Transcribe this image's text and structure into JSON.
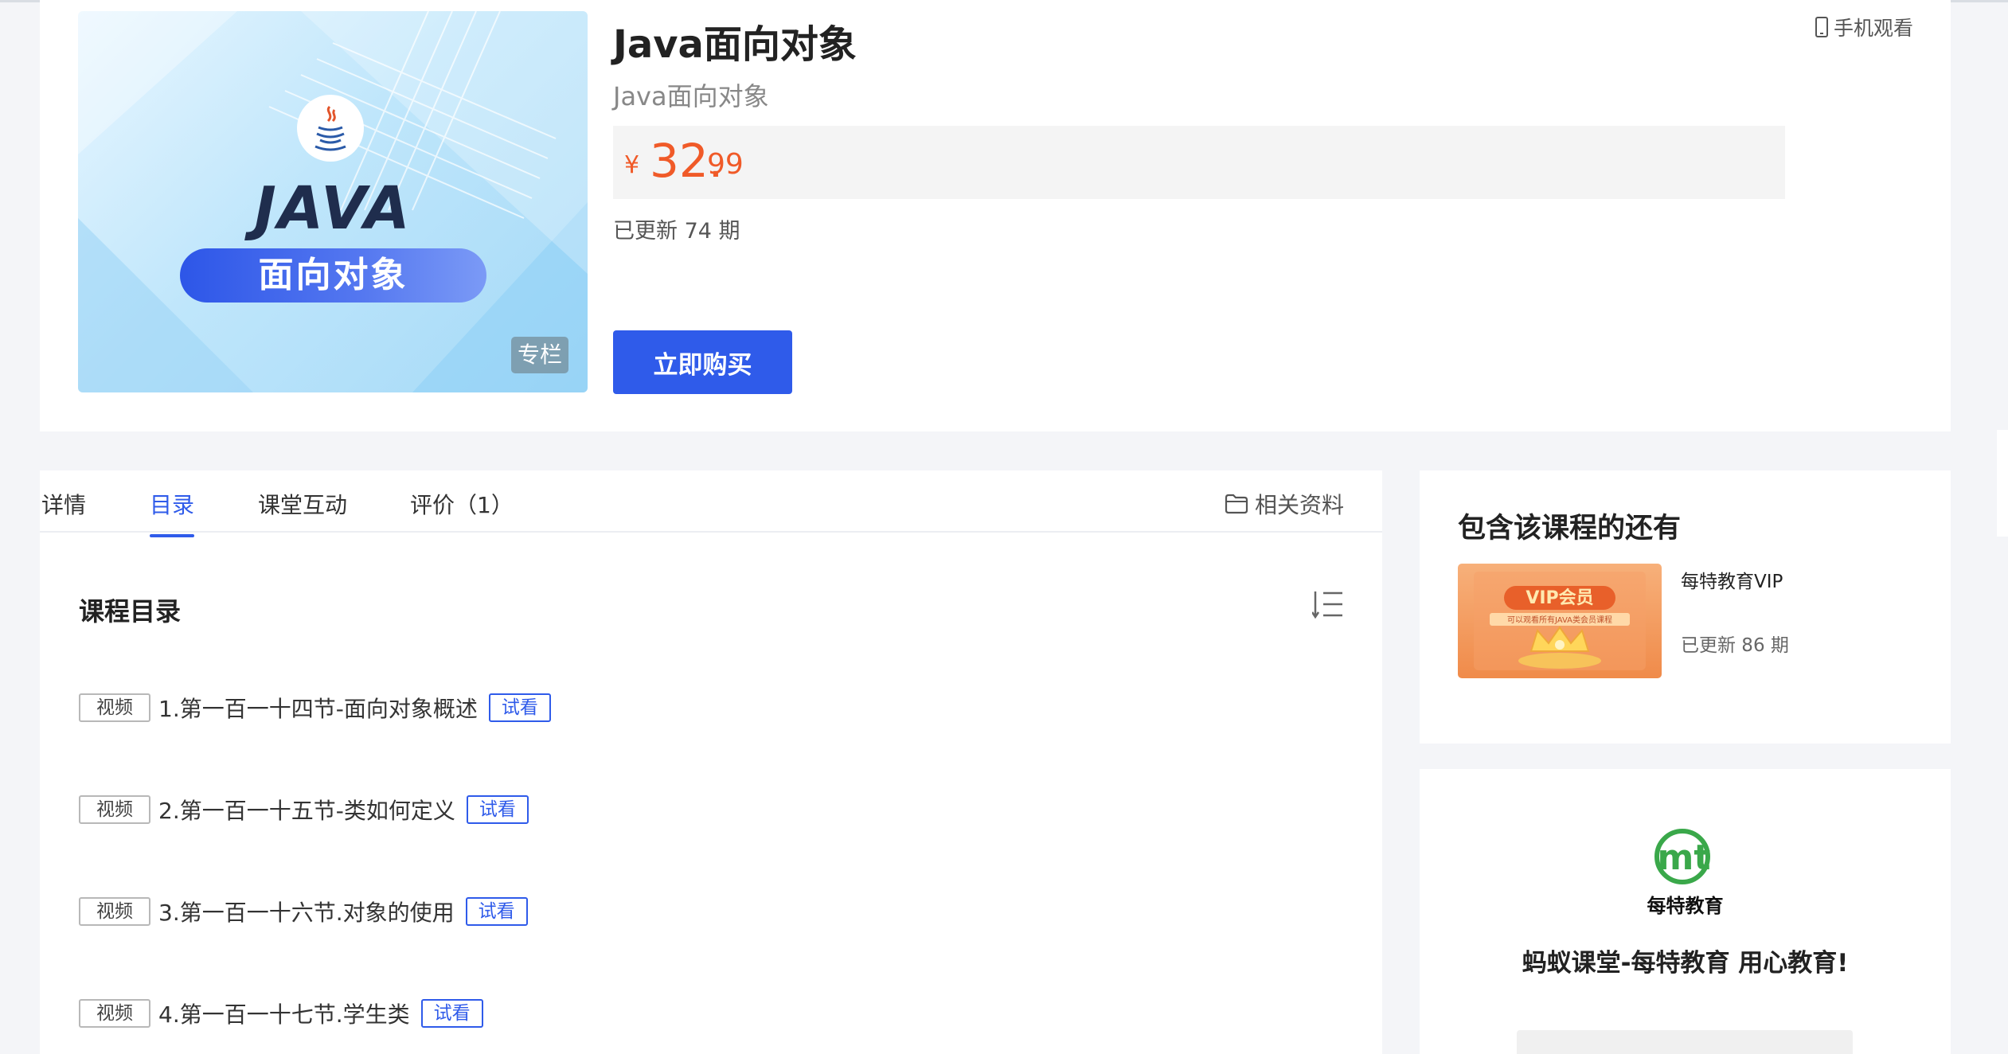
{
  "course": {
    "cover_word": "JAVA",
    "cover_pill": "面向对象",
    "cover_tag": "专栏",
    "title": "Java面向对象",
    "subtitle": "Java面向对象",
    "mobile_label": "手机观看",
    "price_currency": "¥",
    "price_integer": "32.",
    "price_decimal": "99",
    "updated": "已更新 74 期",
    "buy_label": "立即购买"
  },
  "tabs": [
    {
      "label": "详情",
      "active": false
    },
    {
      "label": "目录",
      "active": true
    },
    {
      "label": "课堂互动",
      "active": false
    },
    {
      "label": "评价（1）",
      "active": false
    }
  ],
  "resources_label": "相关资料",
  "catalog": {
    "title": "课程目录",
    "lessons": [
      {
        "type": "视频",
        "title": "1.第一百一十四节-面向对象概述",
        "trial": "试看"
      },
      {
        "type": "视频",
        "title": "2.第一百一十五节-类如何定义",
        "trial": "试看"
      },
      {
        "type": "视频",
        "title": "3.第一百一十六节.对象的使用",
        "trial": "试看"
      },
      {
        "type": "视频",
        "title": "4.第一百一十七节.学生类",
        "trial": "试看"
      }
    ]
  },
  "related": {
    "heading": "包含该课程的还有",
    "vip_badge": "VIP会员",
    "vip_caption": "可以观看所有JAVA类会员课程",
    "item_title": "每特教育VIP",
    "item_updated": "已更新 86 期"
  },
  "brand": {
    "logo_text": "mt",
    "name": "每特教育",
    "slogan": "蚂蚁课堂-每特教育 用心教育!"
  },
  "colors": {
    "accent": "#2f5bea",
    "price": "#f05a28"
  }
}
